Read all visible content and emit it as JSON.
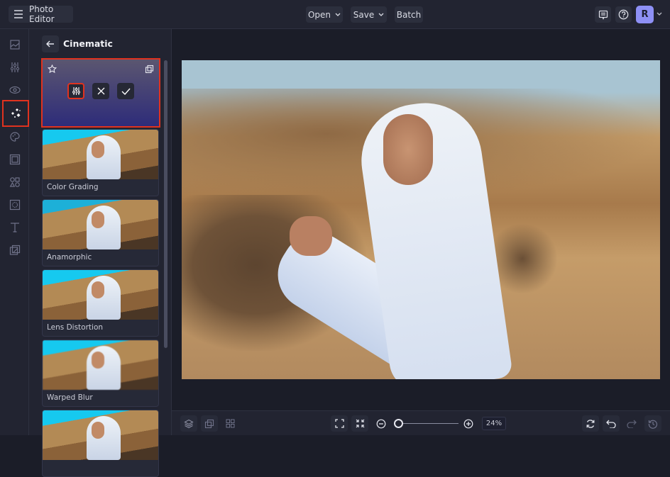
{
  "topbar": {
    "app_title": "Photo Editor",
    "open_label": "Open",
    "save_label": "Save",
    "batch_label": "Batch",
    "avatar_initial": "R"
  },
  "toolrail": {
    "items": [
      {
        "name": "image",
        "icon": "image-icon"
      },
      {
        "name": "adjustments",
        "icon": "sliders-icon"
      },
      {
        "name": "preview",
        "icon": "eye-icon"
      },
      {
        "name": "effects",
        "icon": "sparkles-icon",
        "active": true
      },
      {
        "name": "paint",
        "icon": "palette-icon"
      },
      {
        "name": "frames",
        "icon": "frame-icon"
      },
      {
        "name": "graphics",
        "icon": "shapes-icon"
      },
      {
        "name": "overlays",
        "icon": "texture-icon"
      },
      {
        "name": "text",
        "icon": "text-icon"
      },
      {
        "name": "cutout",
        "icon": "layers-edit-icon"
      }
    ]
  },
  "panel": {
    "title": "Cinematic",
    "presets": [
      {
        "label": "Color Grading"
      },
      {
        "label": "Anamorphic"
      },
      {
        "label": "Lens Distortion"
      },
      {
        "label": "Warped Blur"
      },
      {
        "label": ""
      }
    ]
  },
  "bottombar": {
    "zoom_percent": "24%",
    "zoom_level": 0.24
  },
  "colors": {
    "accent_highlight": "#e0321f",
    "avatar": "#8e90f5",
    "background": "#1b1d28",
    "panel": "#222431"
  }
}
